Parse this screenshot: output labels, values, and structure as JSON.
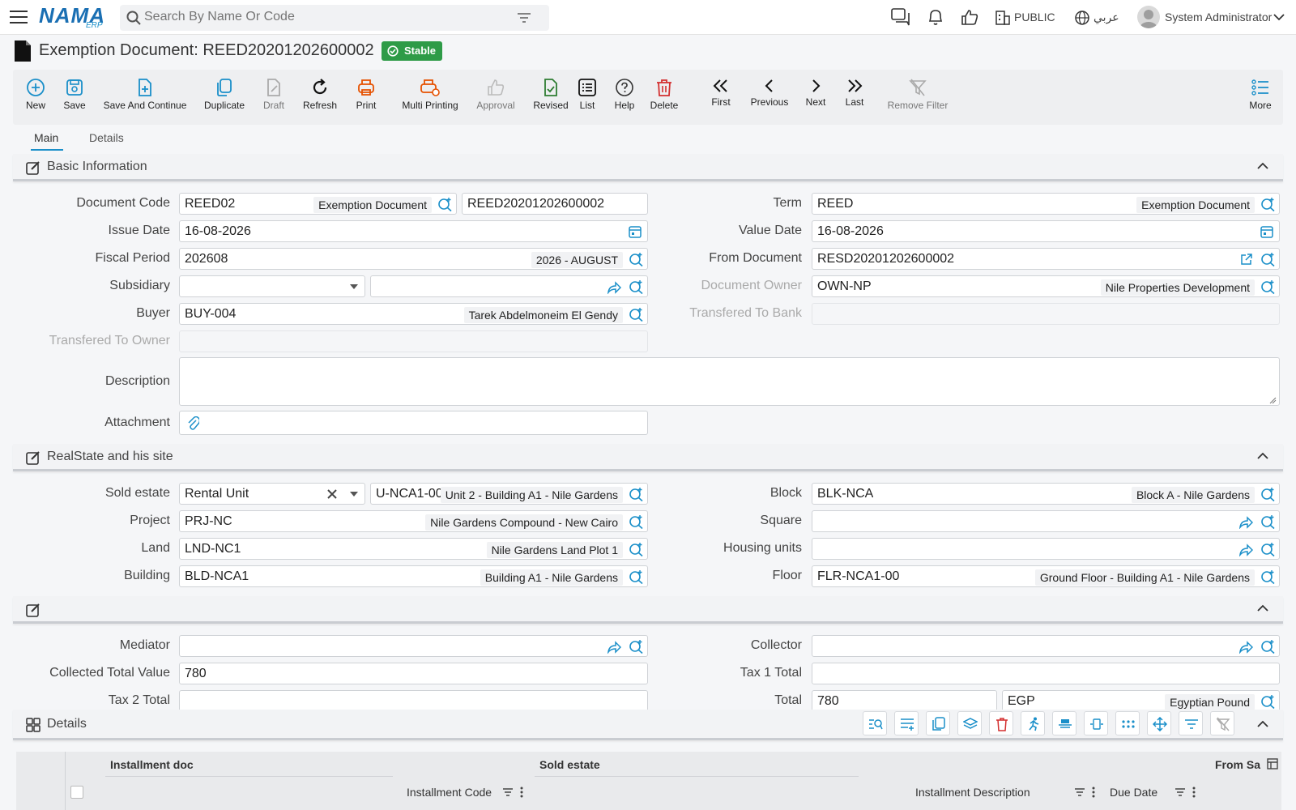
{
  "header": {
    "brand": "NAMA",
    "brand_sub": "ERP",
    "search_placeholder": "Search By Name Or Code",
    "public_label": "PUBLIC",
    "language_label": "عربي",
    "user_name": "System Administrator"
  },
  "page": {
    "title": "Exemption Document: REED20201202600002",
    "status_badge": "Stable"
  },
  "toolbar": {
    "new": "New",
    "save": "Save",
    "save_continue": "Save And Continue",
    "duplicate": "Duplicate",
    "draft": "Draft",
    "refresh": "Refresh",
    "print": "Print",
    "multi_printing": "Multi Printing",
    "approval": "Approval",
    "revised": "Revised",
    "list": "List",
    "help": "Help",
    "delete": "Delete",
    "first": "First",
    "previous": "Previous",
    "next": "Next",
    "last": "Last",
    "remove_filter": "Remove Filter",
    "more": "More"
  },
  "tabs": {
    "main": "Main",
    "details": "Details"
  },
  "basic": {
    "title": "Basic Information",
    "doc_code_label": "Document Code",
    "doc_code": "REED02",
    "doc_code_name": "Exemption Document",
    "doc_number": "REED20201202600002",
    "term_label": "Term",
    "term": "REED",
    "term_name": "Exemption Document",
    "issue_date_label": "Issue Date",
    "issue_date": "16-08-2026",
    "value_date_label": "Value Date",
    "value_date": "16-08-2026",
    "fiscal_label": "Fiscal Period",
    "fiscal": "202608",
    "fiscal_name": "2026 - AUGUST",
    "from_doc_label": "From Document",
    "from_doc": "RESD20201202600002",
    "subsidiary_label": "Subsidiary",
    "owner_label": "Document Owner",
    "owner": "OWN-NP",
    "owner_name": "Nile Properties Development",
    "buyer_label": "Buyer",
    "buyer": "BUY-004",
    "buyer_name": "Tarek Abdelmoneim El Gendy",
    "bank_label": "Transfered To Bank",
    "to_owner_label": "Transfered To Owner",
    "description_label": "Description",
    "attachment_label": "Attachment"
  },
  "realstate": {
    "title": "RealState and his site",
    "sold_label": "Sold estate",
    "sold_type": "Rental Unit",
    "sold_code": "U-NCA1-00",
    "sold_name": "Unit 2 - Building A1 - Nile Gardens",
    "block_label": "Block",
    "block": "BLK-NCA",
    "block_name": "Block A - Nile Gardens",
    "project_label": "Project",
    "project": "PRJ-NC",
    "project_name": "Nile Gardens Compound - New Cairo",
    "square_label": "Square",
    "land_label": "Land",
    "land": "LND-NC1",
    "land_name": "Nile Gardens Land Plot 1",
    "housing_label": "Housing units",
    "building_label": "Building",
    "building": "BLD-NCA1",
    "building_name": "Building A1 - Nile Gardens",
    "floor_label": "Floor",
    "floor": "FLR-NCA1-00",
    "floor_name": "Ground Floor - Building A1 - Nile Gardens"
  },
  "totals": {
    "mediator_label": "Mediator",
    "collector_label": "Collector",
    "collected_label": "Collected Total Value",
    "collected": "780",
    "tax1_label": "Tax 1 Total",
    "tax2_label": "Tax 2 Total",
    "total_label": "Total",
    "total": "780",
    "currency": "EGP",
    "currency_name": "Egyptian Pound"
  },
  "details": {
    "title": "Details",
    "col_installment_doc": "Installment doc",
    "col_installment_code": "Installment Code",
    "col_sold_estate": "Sold estate",
    "col_installment_desc": "Installment Description",
    "col_due_date": "Due Date",
    "col_from_sa": "From Sa"
  },
  "colors": {
    "accent": "#1a8fc9",
    "brand": "#1a6fb3",
    "danger": "#d32f2f",
    "print": "#e65100",
    "ok": "#2e7d32"
  }
}
